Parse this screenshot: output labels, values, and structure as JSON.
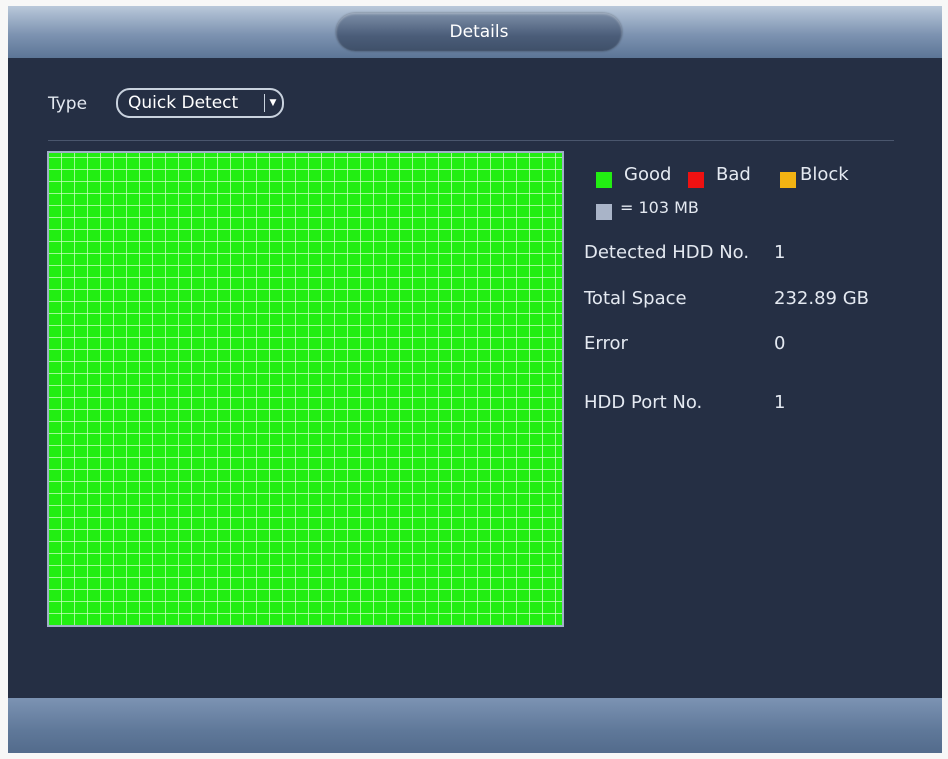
{
  "window": {
    "title": "Details"
  },
  "type_field": {
    "label": "Type",
    "selected": "Quick Detect"
  },
  "legend": {
    "good_label": "Good",
    "bad_label": "Bad",
    "block_label": "Block",
    "unit_label": "= 103 MB",
    "colors": {
      "good": "#22ee12",
      "bad": "#ee1111",
      "block": "#f2b312",
      "unit": "#a9b4c8"
    }
  },
  "info": {
    "detected_hdd_label": "Detected HDD No.",
    "detected_hdd_value": "1",
    "total_space_label": "Total Space",
    "total_space_value": "232.89 GB",
    "error_label": "Error",
    "error_value": "0",
    "hdd_port_label": "HDD Port No.",
    "hdd_port_value": "1"
  },
  "block_map": {
    "status": "all good"
  }
}
